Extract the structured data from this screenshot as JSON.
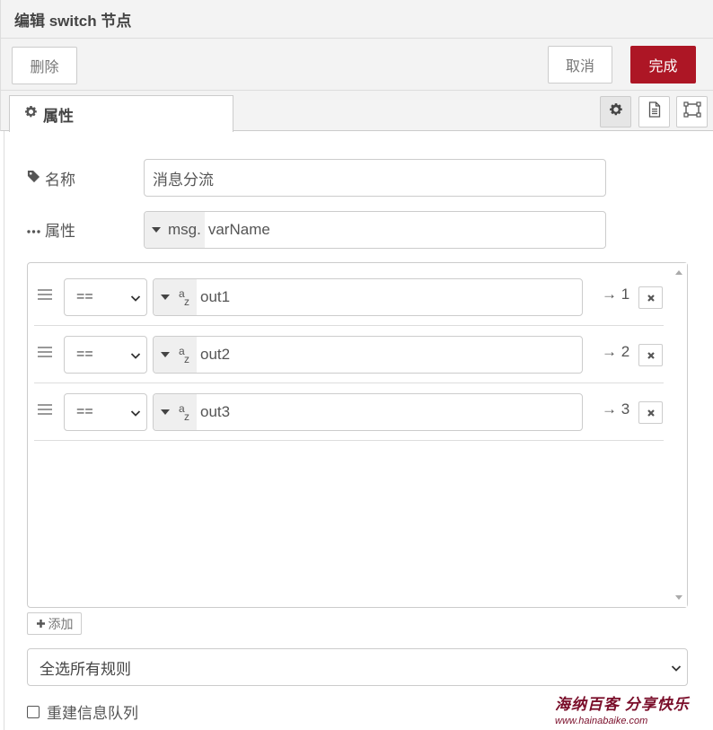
{
  "header": {
    "title": "编辑 switch 节点"
  },
  "toolbar": {
    "delete_label": "删除",
    "cancel_label": "取消",
    "done_label": "完成"
  },
  "tabs": {
    "properties_label": "属性"
  },
  "form": {
    "name_label": "名称",
    "name_value": "消息分流",
    "property_label": "属性",
    "property_type": "msg.",
    "property_value": "varName"
  },
  "rules": [
    {
      "operator": "==",
      "value": "out1",
      "output": "→ 1"
    },
    {
      "operator": "==",
      "value": "out2",
      "output": "→ 2"
    },
    {
      "operator": "==",
      "value": "out3",
      "output": "→ 3"
    }
  ],
  "add_label": "添加",
  "check_mode": "全选所有规则",
  "recreate_label": "重建信息队列",
  "watermark": {
    "line1": "海纳百客 分享快乐",
    "line2": "www.hainabaike.com"
  },
  "colors": {
    "primary": "#ad1625",
    "border": "#cccccc",
    "toolbar_bg": "#f3f3f3"
  }
}
